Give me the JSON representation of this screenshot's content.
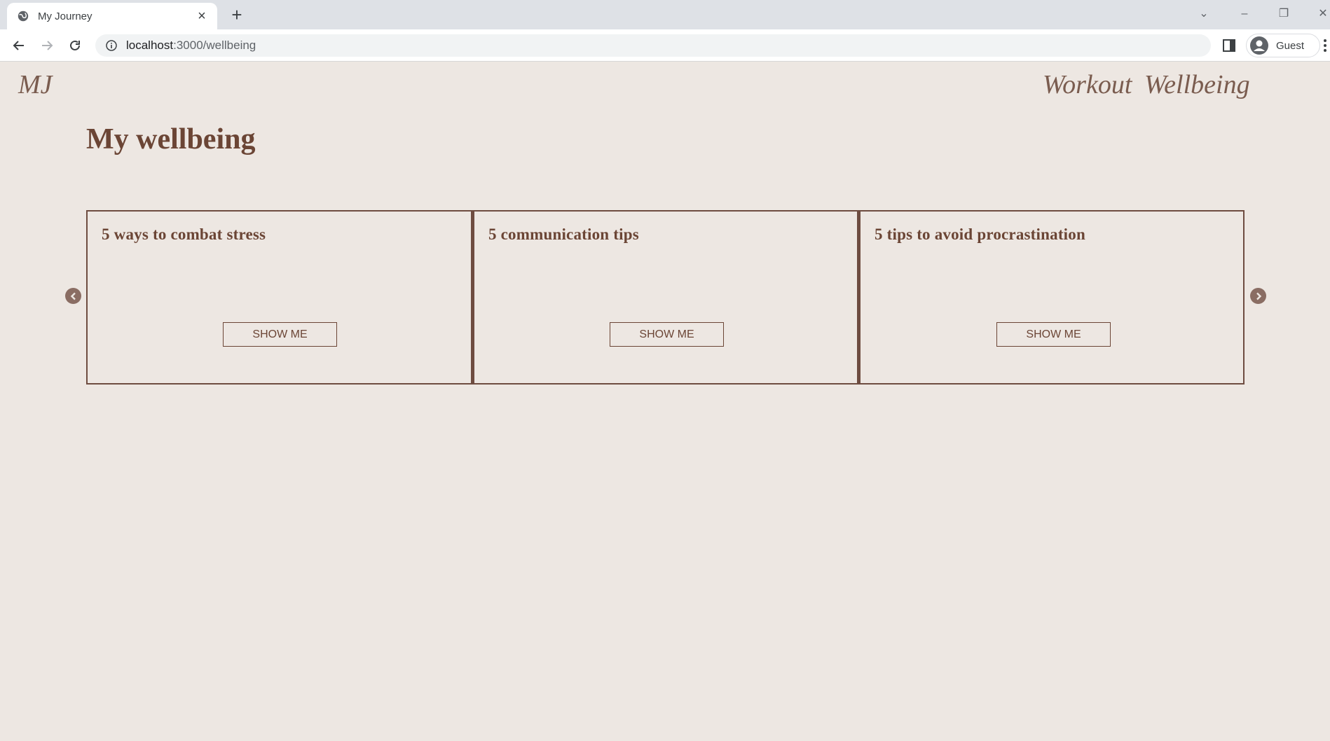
{
  "browser": {
    "tab_title": "My Journey",
    "url_host": "localhost",
    "url_path": ":3000/wellbeing",
    "profile_label": "Guest"
  },
  "header": {
    "brand": "MJ",
    "nav": [
      "Workout",
      "Wellbeing"
    ]
  },
  "main": {
    "title": "My wellbeing",
    "cards": [
      {
        "title": "5 ways to combat stress",
        "button": "SHOW ME"
      },
      {
        "title": "5 communication tips",
        "button": "SHOW ME"
      },
      {
        "title": "5 tips to avoid procrastination",
        "button": "SHOW ME"
      }
    ]
  },
  "icons": {
    "prev": "chevron-left-circle-icon",
    "next": "chevron-right-circle-icon"
  },
  "colors": {
    "background": "#ede7e2",
    "accent": "#6b4535",
    "nav_text": "#7a5c4f"
  }
}
